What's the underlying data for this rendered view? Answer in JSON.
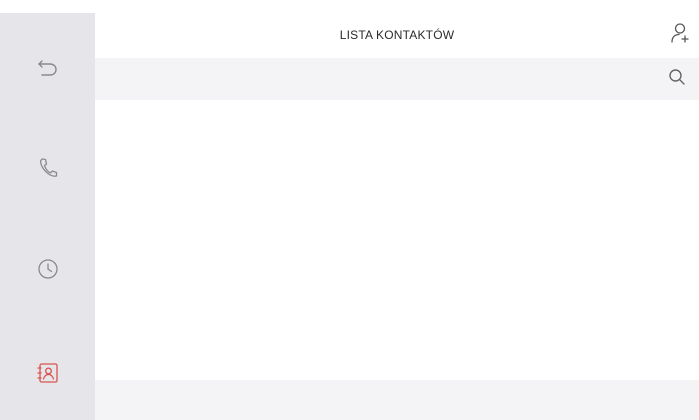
{
  "header": {
    "title": "LISTA KONTAKTÓW",
    "add_contact_icon": "add-contact-icon"
  },
  "search": {
    "placeholder": "",
    "value": "",
    "icon": "search-icon"
  },
  "sidebar": {
    "items": [
      {
        "id": "back",
        "icon": "back-arrow-icon",
        "active": false
      },
      {
        "id": "call",
        "icon": "phone-icon",
        "active": false
      },
      {
        "id": "history",
        "icon": "clock-icon",
        "active": false
      },
      {
        "id": "contacts",
        "icon": "contacts-book-icon",
        "active": true
      }
    ]
  },
  "contacts": [],
  "colors": {
    "sidebar_bg": "#e6e6ea",
    "icon": "#8a8a8a",
    "active_icon": "#d9534f",
    "header_bg": "#ffffff",
    "search_bg": "#f4f4f6"
  }
}
